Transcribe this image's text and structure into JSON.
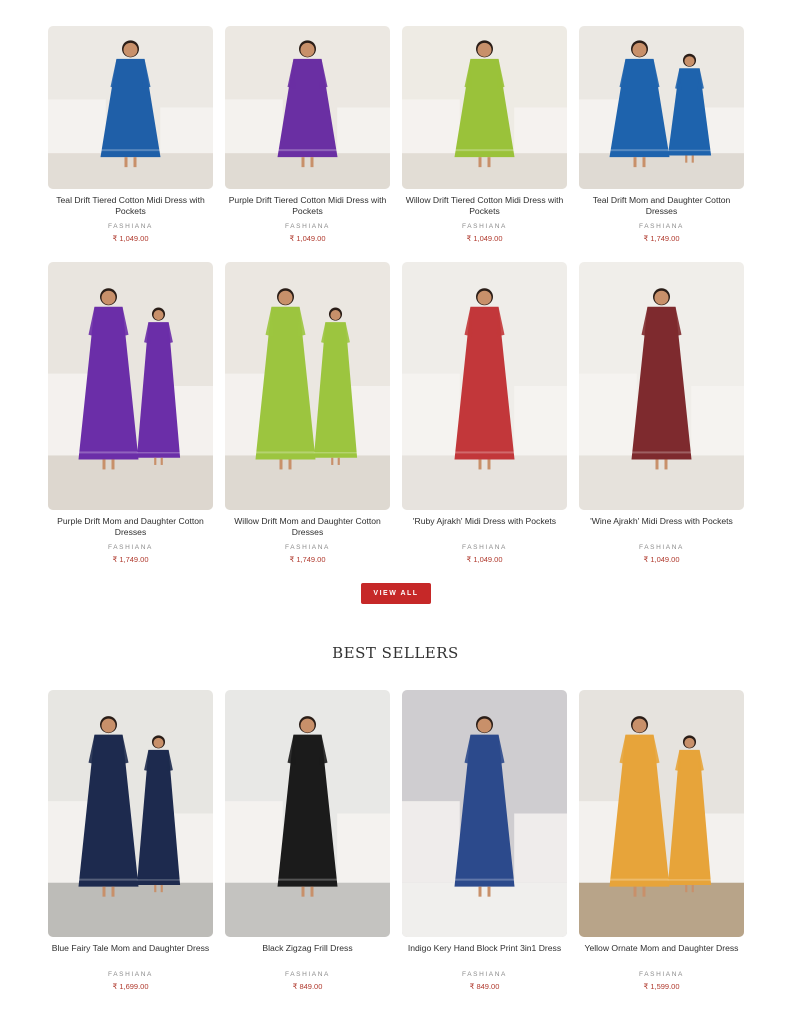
{
  "row1": [
    {
      "title": "Teal Drift Tiered Cotton Midi Dress with Pockets",
      "vendor": "FASHIANA",
      "price": "₹ 1,049.00",
      "bg": "#ece9e4",
      "dress": "#1f5fa8",
      "floor": "#e2ddd6"
    },
    {
      "title": "Purple Drift Tiered Cotton Midi Dress with Pockets",
      "vendor": "FASHIANA",
      "price": "₹ 1,049.00",
      "bg": "#ece8e2",
      "dress": "#6a2fa3",
      "floor": "#e0dbd3"
    },
    {
      "title": "Willow Drift Tiered Cotton Midi Dress with Pockets",
      "vendor": "FASHIANA",
      "price": "₹ 1,049.00",
      "bg": "#eeebe4",
      "dress": "#9ac23a",
      "floor": "#e2ddd5"
    },
    {
      "title": "Teal Drift Mom and Daughter Cotton Dresses",
      "vendor": "FASHIANA",
      "price": "₹ 1,749.00",
      "bg": "#ebe8e3",
      "dress": "#1e63ad",
      "floor": "#dfdad3"
    }
  ],
  "row2": [
    {
      "title": "Purple Drift Mom and Daughter Cotton Dresses",
      "vendor": "FASHIANA",
      "price": "₹ 1,749.00",
      "bg": "#e9e5df",
      "dress": "#6b2ea8",
      "floor": "#ddd7cf"
    },
    {
      "title": "Willow Drift Mom and Daughter Cotton Dresses",
      "vendor": "FASHIANA",
      "price": "₹ 1,749.00",
      "bg": "#ebe7e1",
      "dress": "#9cc53f",
      "floor": "#ded9d1"
    },
    {
      "title": "'Ruby Ajrakh' Midi Dress with Pockets",
      "vendor": "FASHIANA",
      "price": "₹ 1,049.00",
      "bg": "#efede9",
      "dress": "#c2373a",
      "floor": "#e7e3de"
    },
    {
      "title": "'Wine Ajrakh' Midi Dress with Pockets",
      "vendor": "FASHIANA",
      "price": "₹ 1,049.00",
      "bg": "#f0eeea",
      "dress": "#7e2a2e",
      "floor": "#e6e2dc"
    }
  ],
  "view_all": "VIEW ALL",
  "best_sellers_title": "BEST SELLERS",
  "row3": [
    {
      "title": "Blue Fairy Tale Mom and Daughter Dress",
      "vendor": "FASHIANA",
      "price": "₹ 1,699.00",
      "bg": "#e7e6e2",
      "dress": "#1d2a4e",
      "floor": "#bdbcb8"
    },
    {
      "title": "Black Zigzag Frill Dress",
      "vendor": "FASHIANA",
      "price": "₹ 849.00",
      "bg": "#e8e8e6",
      "dress": "#1b1b1b",
      "floor": "#c4c3c0"
    },
    {
      "title": "Indigo Kery Hand Block Print 3in1 Dress",
      "vendor": "FASHIANA",
      "price": "₹ 849.00",
      "bg": "#cfcdd0",
      "dress": "#2c4a8c",
      "floor": "#f0efed"
    },
    {
      "title": "Yellow Ornate Mom and Daughter Dress",
      "vendor": "FASHIANA",
      "price": "₹ 1,599.00",
      "bg": "#e6e3de",
      "dress": "#e7a43a",
      "floor": "#b8a489"
    }
  ]
}
